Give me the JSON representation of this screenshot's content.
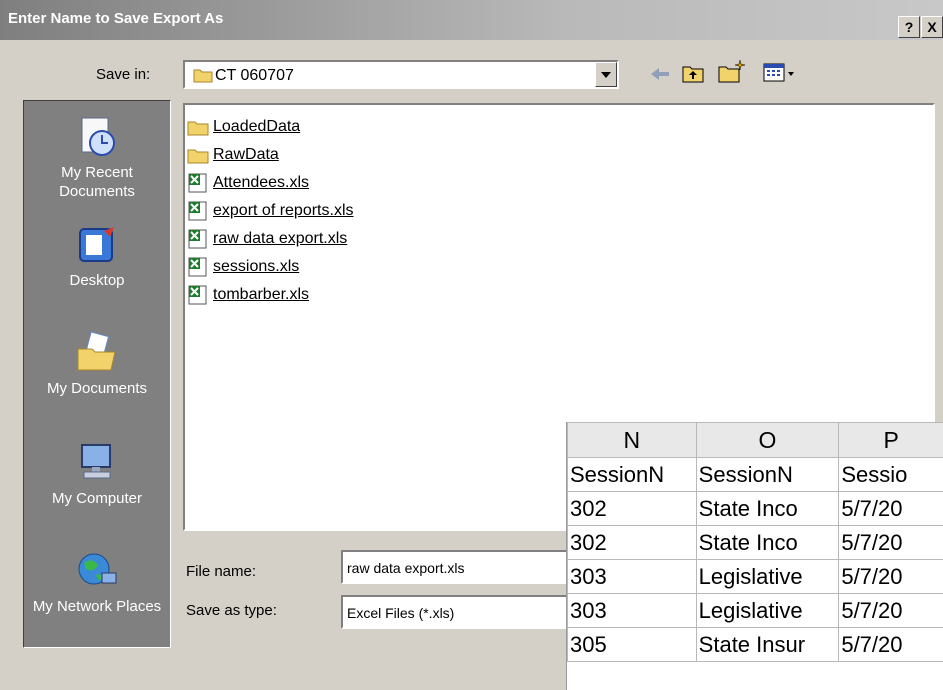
{
  "window": {
    "title": "Enter Name to Save Export As",
    "help_label": "?",
    "close_label": "X"
  },
  "toolbar": {
    "save_in_label": "Save in:",
    "save_in_value": "CT 060707"
  },
  "places": [
    {
      "label": "My Recent Documents",
      "icon": "recent-documents-icon"
    },
    {
      "label": "Desktop",
      "icon": "desktop-icon"
    },
    {
      "label": "My Documents",
      "icon": "my-documents-icon"
    },
    {
      "label": "My Computer",
      "icon": "my-computer-icon"
    },
    {
      "label": "My Network Places",
      "icon": "network-places-icon"
    }
  ],
  "files": [
    {
      "name": "LoadedData",
      "type": "folder"
    },
    {
      "name": "RawData",
      "type": "folder"
    },
    {
      "name": "Attendees.xls",
      "type": "excel"
    },
    {
      "name": "export of reports.xls",
      "type": "excel"
    },
    {
      "name": "raw data export.xls",
      "type": "excel"
    },
    {
      "name": "sessions.xls",
      "type": "excel"
    },
    {
      "name": "tombarber.xls",
      "type": "excel"
    }
  ],
  "form": {
    "file_name_label": "File name:",
    "file_name_value": "raw data export.xls",
    "save_as_type_label": "Save as type:",
    "save_as_type_value": "Excel Files (*.xls)"
  },
  "spreadsheet": {
    "columns": [
      "N",
      "O",
      "P"
    ],
    "header_row": [
      "SessionN",
      "SessionN",
      "Sessio"
    ],
    "rows": [
      [
        "302",
        "State Inco",
        "5/7/20"
      ],
      [
        "302",
        "State Inco",
        "5/7/20"
      ],
      [
        "303",
        "Legislative",
        "5/7/20"
      ],
      [
        "303",
        "Legislative",
        "5/7/20"
      ],
      [
        "305",
        "State Insur",
        "5/7/20"
      ]
    ]
  },
  "colors": {
    "dialog_bg": "#d4d0c8",
    "places_bg": "#808080",
    "folder": "#f2d36b",
    "excel": "#1e7b2e"
  }
}
